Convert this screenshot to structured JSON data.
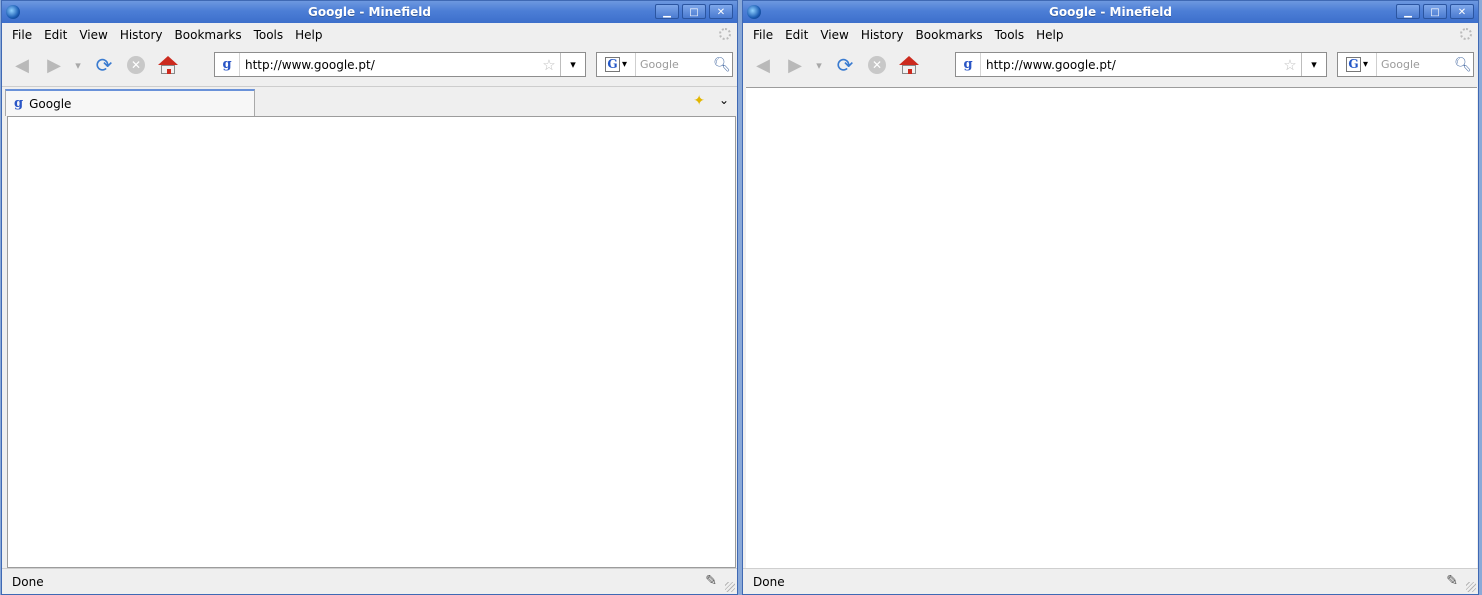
{
  "windows": [
    {
      "title": "Google - Minefield",
      "menu": [
        "File",
        "Edit",
        "View",
        "History",
        "Bookmarks",
        "Tools",
        "Help"
      ],
      "url": "http://www.google.pt/",
      "search_placeholder": "Google",
      "tabs": [
        {
          "label": "Google"
        }
      ],
      "status": "Done"
    },
    {
      "title": "Google - Minefield",
      "menu": [
        "File",
        "Edit",
        "View",
        "History",
        "Bookmarks",
        "Tools",
        "Help"
      ],
      "url": "http://www.google.pt/",
      "search_placeholder": "Google",
      "status": "Done"
    }
  ],
  "icons": {
    "minimize": "minimize-icon",
    "maximize": "maximize-icon",
    "close": "close-icon",
    "back": "back-arrow-icon",
    "forward": "forward-arrow-icon",
    "history_dropdown": "chevron-down-icon",
    "reload": "reload-icon",
    "stop": "stop-icon",
    "home": "home-icon",
    "favicon": "google-g-icon",
    "bookmark_star": "star-icon",
    "search": "magnifier-icon",
    "new_tab": "new-tab-star-icon",
    "tab_list": "chevron-down-icon",
    "status_edit": "edit-note-icon"
  },
  "colors": {
    "titlebar": "#4c7ed6",
    "home_roof": "#cc2a1e",
    "accent": "#3a7bd0"
  }
}
